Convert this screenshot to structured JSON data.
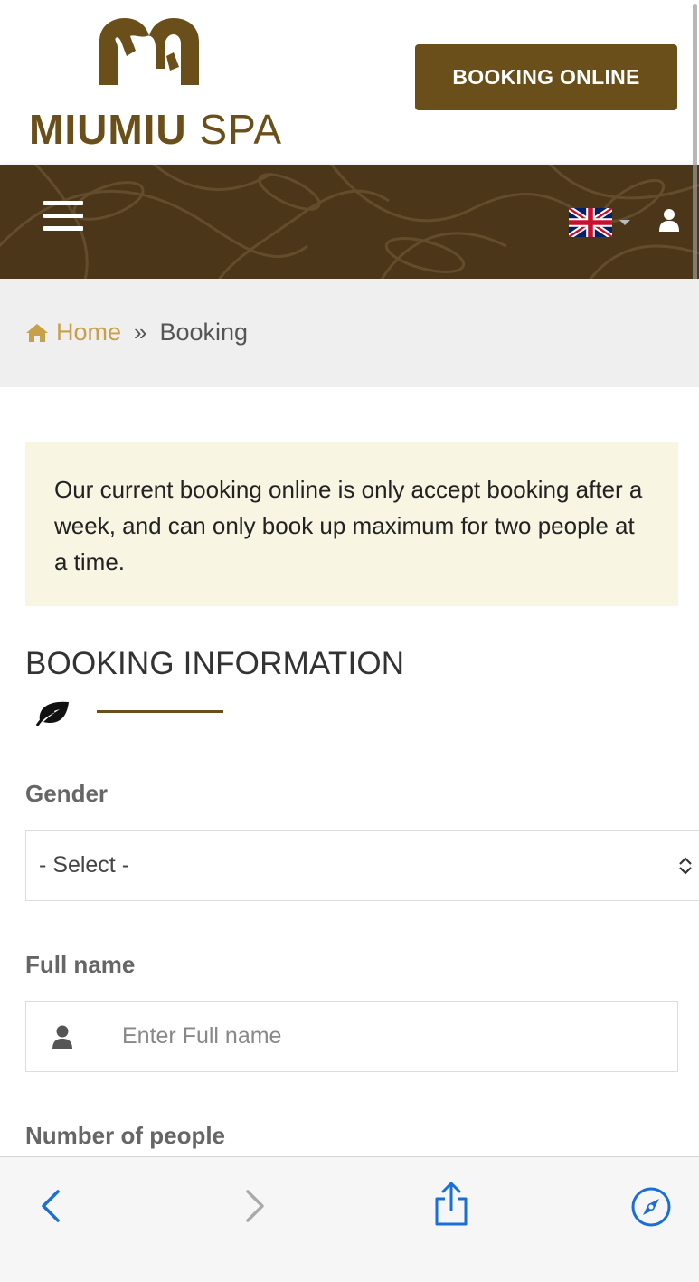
{
  "header": {
    "logo_text_bold": "MIUMIU",
    "logo_text_light": "SPA",
    "booking_button_label": "BOOKING ONLINE"
  },
  "nav": {
    "menu_icon": "hamburger-icon",
    "language_icon": "uk-flag-icon",
    "user_icon": "user-icon"
  },
  "breadcrumb": {
    "home_label": "Home",
    "separator": "»",
    "current_label": "Booking"
  },
  "notice": {
    "text": "Our current booking online is only accept booking after a week, and can only book up maximum for two people at a time."
  },
  "form": {
    "section_title": "BOOKING INFORMATION",
    "gender_label": "Gender",
    "gender_value": "- Select -",
    "fullname_label": "Full name",
    "fullname_placeholder": "Enter Full name",
    "people_label": "Number of people"
  },
  "browser_toolbar": {
    "icons": [
      "back-icon",
      "forward-icon",
      "share-icon",
      "compass-icon"
    ]
  },
  "colors": {
    "brand": "#6b4f1a",
    "breadcrumb_link": "#c7a04a",
    "notice_bg": "#f8f5e3"
  }
}
